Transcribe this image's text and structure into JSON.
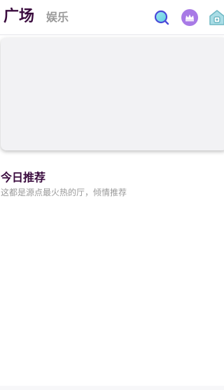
{
  "header": {
    "tabs": [
      {
        "label": "广场",
        "active": true
      },
      {
        "label": "娱乐",
        "active": false
      }
    ],
    "icons": [
      "search-icon",
      "crown-icon",
      "home-icon"
    ]
  },
  "recommend": {
    "title": "今日推荐",
    "subtitle": "这都是源点最火热的厅，倾情推荐"
  },
  "colors": {
    "title": "#3a0b3e",
    "muted": "#9a9a9a",
    "accent_purple": "#a87ae6",
    "search_blue": "#4a4ad8",
    "home_teal": "#6fb8c4"
  }
}
